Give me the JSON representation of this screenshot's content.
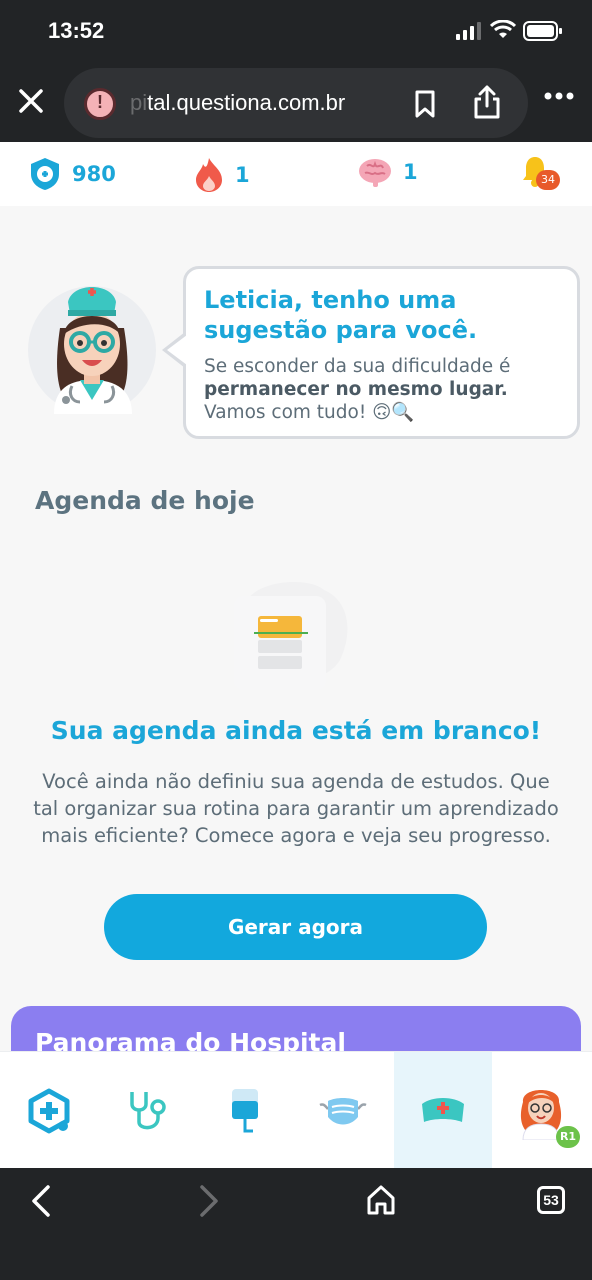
{
  "status_bar": {
    "time": "13:52"
  },
  "browser": {
    "url_faded": "pi",
    "url_visible": "tal.questiona.com.br",
    "tab_count": "53"
  },
  "stats": {
    "points": "980",
    "streak": "1",
    "brain": "1",
    "notifications": "34"
  },
  "assistant": {
    "title": "Leticia, tenho uma sugestão para você.",
    "message_part1": "Se esconder da sua dificuldade é ",
    "message_bold": "permanecer no mesmo lugar.",
    "message_part2": " Vamos com tudo! 🙃🔍"
  },
  "agenda": {
    "heading": "Agenda de hoje",
    "empty_title": "Sua agenda ainda está em branco!",
    "empty_text": "Você ainda não definiu sua agenda de estudos. Que tal organizar sua rotina para garantir um aprendizado mais eficiente? Comece agora e veja seu progresso.",
    "button": "Gerar agora"
  },
  "panorama": {
    "title": "Panorama do Hospital"
  },
  "tabbar": {
    "tabs": [
      {
        "icon": "hospital-cross-icon"
      },
      {
        "icon": "stethoscope-icon"
      },
      {
        "icon": "iv-bag-icon"
      },
      {
        "icon": "mask-icon"
      },
      {
        "icon": "nurse-cap-icon",
        "active": true
      },
      {
        "icon": "profile-avatar-icon"
      }
    ],
    "level_badge": "R1"
  },
  "colors": {
    "accent": "#1ba6d8",
    "button": "#12a8dd",
    "panorama": "#8b7ef0",
    "text_muted": "#5d6d78",
    "chrome": "#222426"
  }
}
